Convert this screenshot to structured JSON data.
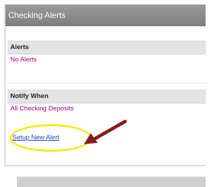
{
  "panel": {
    "title": "Checking Alerts"
  },
  "alerts_section": {
    "heading": "Alerts",
    "value": "No Alerts"
  },
  "notify_section": {
    "heading": "Notify When",
    "value": "All Checking Deposits"
  },
  "setup_link": {
    "label": "Setup New Alert"
  },
  "annotations": {
    "highlight_color": "#f4ec1a",
    "arrow_color": "#8b1a1a"
  }
}
